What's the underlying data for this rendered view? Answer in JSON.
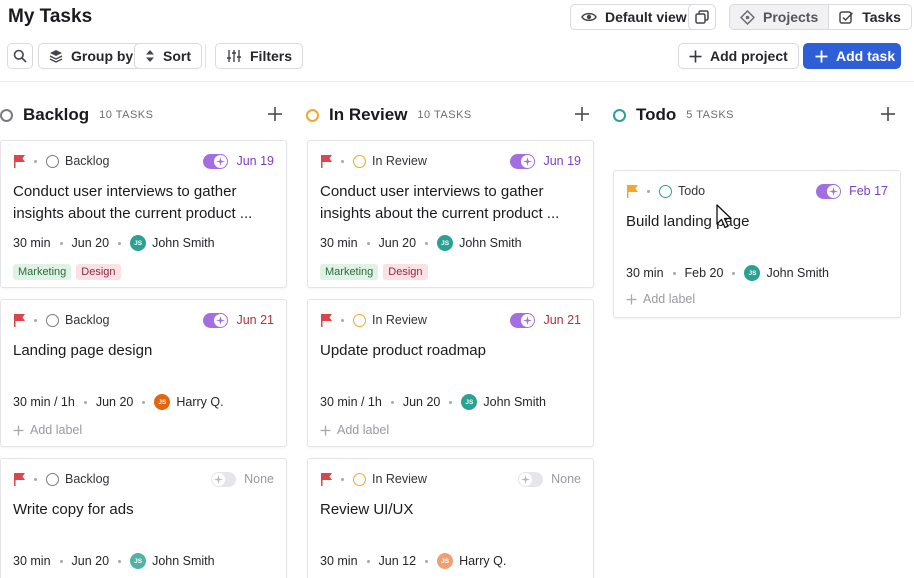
{
  "header": {
    "title": "My Tasks",
    "default_view_label": "Default view",
    "projects_label": "Projects",
    "tasks_label": "Tasks"
  },
  "toolbar": {
    "group_by_label": "Group by",
    "sort_label": "Sort",
    "filters_label": "Filters",
    "add_project_label": "Add project",
    "add_task_label": "Add task"
  },
  "colors": {
    "accent": "#2f5fd6",
    "backlog": "#7a7a80",
    "in_review": "#f0a92b",
    "todo": "#2aa192",
    "ai_on": "#a36fe0",
    "flag_red": "#d9464b",
    "flag_orange": "#f0a92b",
    "due_purple": "#7a3fc6",
    "due_red": "#b3313a"
  },
  "columns": [
    {
      "name": "Backlog",
      "count": "10 TASKS",
      "cards": [
        {
          "status": "Backlog",
          "due": "Jun 19",
          "title": "Conduct user interviews to gather insights about the current product ...",
          "duration": "30 min",
          "date": "Jun 20",
          "assignee": "John Smith",
          "avatar_initials": "JS",
          "tags": [
            "Marketing",
            "Design"
          ]
        },
        {
          "status": "Backlog",
          "due": "Jun 21",
          "title": "Landing page design",
          "duration": "30 min / 1h",
          "date": "Jun 20",
          "assignee": "Harry Q.",
          "avatar_initials": "JS",
          "add_label": "Add label"
        },
        {
          "status": "Backlog",
          "due": "None",
          "title": "Write copy for ads",
          "duration": "30 min",
          "date": "Jun 20",
          "assignee": "John Smith",
          "avatar_initials": "JS"
        }
      ]
    },
    {
      "name": "In Review",
      "count": "10 TASKS",
      "cards": [
        {
          "status": "In Review",
          "due": "Jun 19",
          "title": "Conduct user interviews to gather insights about the current product ...",
          "duration": "30 min",
          "date": "Jun 20",
          "assignee": "John Smith",
          "avatar_initials": "JS",
          "tags": [
            "Marketing",
            "Design"
          ]
        },
        {
          "status": "In Review",
          "due": "Jun 21",
          "title": "Update product roadmap",
          "duration": "30 min / 1h",
          "date": "Jun 20",
          "assignee": "John Smith",
          "avatar_initials": "JS",
          "add_label": "Add label"
        },
        {
          "status": "In Review",
          "due": "None",
          "title": "Review UI/UX",
          "duration": "30 min",
          "date": "Jun 12",
          "assignee": "Harry Q.",
          "avatar_initials": "JS"
        }
      ]
    },
    {
      "name": "Todo",
      "count": "5 TASKS",
      "cards": [
        {
          "status": "Todo",
          "due": "Feb 17",
          "title": "Build landing page",
          "duration": "30 min",
          "date": "Feb 20",
          "assignee": "John Smith",
          "avatar_initials": "JS",
          "add_label": "Add label"
        }
      ]
    }
  ]
}
